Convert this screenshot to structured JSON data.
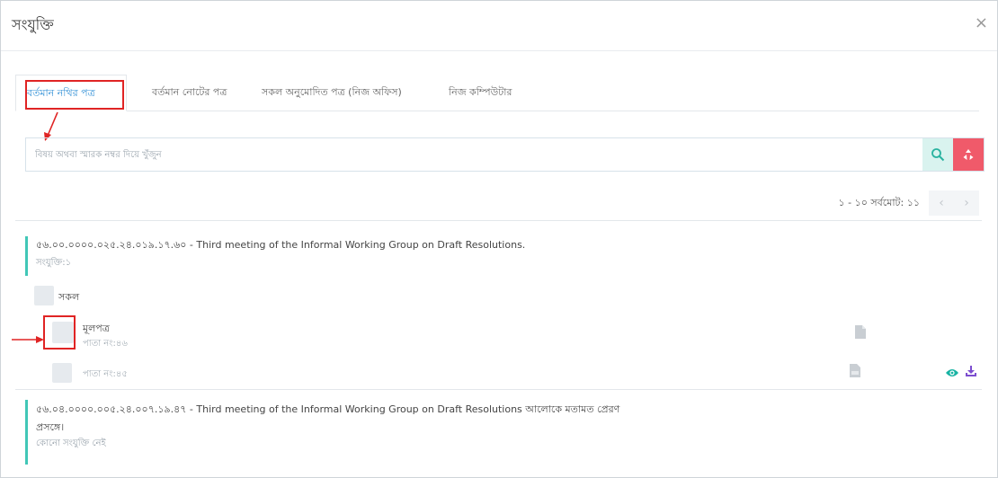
{
  "modal": {
    "title": "সংযুক্তি",
    "close_label": "×"
  },
  "tabs": [
    {
      "label": "বর্তমান নথির পত্র",
      "active": true
    },
    {
      "label": "বর্তমান নোটের পত্র",
      "active": false
    },
    {
      "label": "সকল অনুমোদিত পত্র (নিজ অফিস)",
      "active": false
    },
    {
      "label": "নিজ কম্পিউটার",
      "active": false
    }
  ],
  "search": {
    "placeholder": "বিষয় অথবা স্মারক নম্বর দিয়ে খুঁজুন",
    "value": ""
  },
  "pagination": {
    "text": "১ - ১০ সর্বমোট: ১১",
    "prev": "‹",
    "next": "›"
  },
  "groups": [
    {
      "title": "৫৬.০০.০০০০.০২৫.২৪.০১৯.১৭.৬০ - Third meeting of the Informal Working Group on Draft Resolutions.",
      "subtitle": "সংযুক্তি:১",
      "select_all_label": "সকল",
      "items": [
        {
          "name": "মূলপত্র",
          "pages": "পাতা নং:৪৬"
        },
        {
          "name": "",
          "pages": "পাতা নং:৪৫"
        }
      ]
    },
    {
      "title": "৫৬.০৪.০০০০.০০৫.২৪.০০৭.১৯.৪৭ - Third meeting of the Informal Working Group on Draft Resolutions আলোকে মতামত প্রেরণ",
      "title_cont": "প্রসঙ্গে।",
      "subtitle": "কোনো সংযুক্তি নেই"
    }
  ],
  "colors": {
    "accent": "#2f8fd6",
    "teal": "#41c7b7",
    "highlight": "#e02424",
    "danger": "#f05a6a"
  }
}
